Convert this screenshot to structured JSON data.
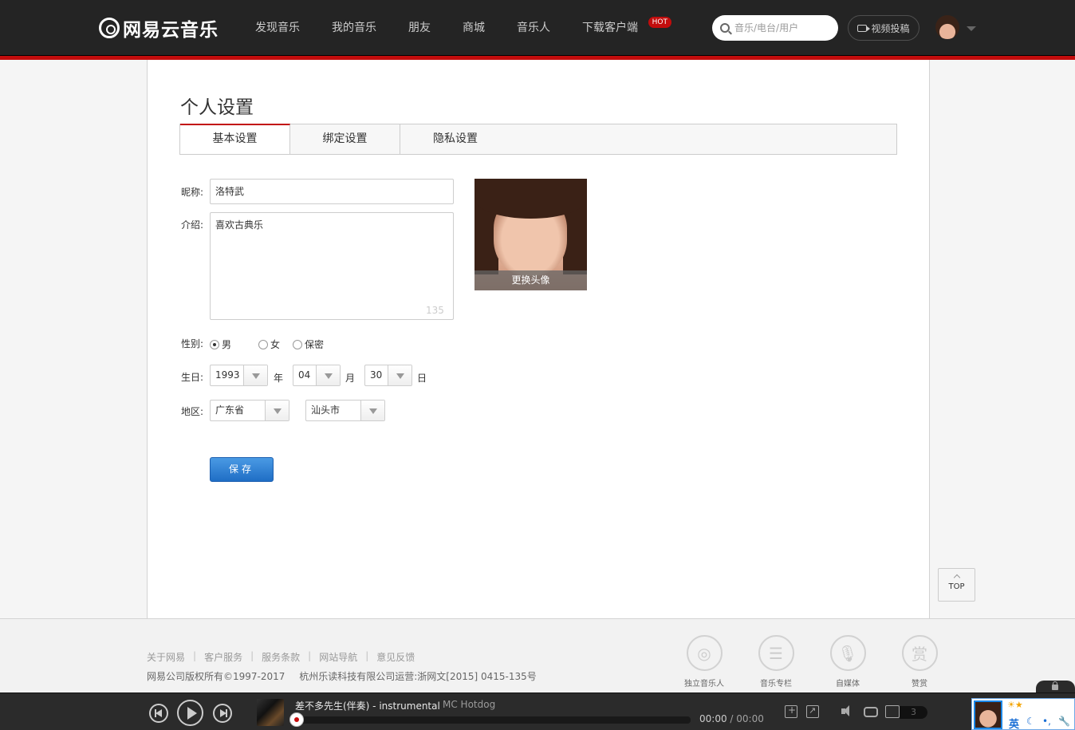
{
  "nav": {
    "logo_text": "网易云音乐",
    "items": [
      "发现音乐",
      "我的音乐",
      "朋友",
      "商城",
      "音乐人",
      "下载客户端"
    ],
    "hot_badge": "HOT",
    "search_placeholder": "音乐/电台/用户",
    "upload_label": "视频投稿"
  },
  "page": {
    "title": "个人设置",
    "tabs": [
      "基本设置",
      "绑定设置",
      "隐私设置"
    ],
    "active_tab": "基本设置"
  },
  "form": {
    "nickname_label": "昵称:",
    "nickname_value": "洛特武",
    "intro_label": "介绍:",
    "intro_value": "喜欢古典乐",
    "intro_remaining": "135",
    "avatar_change_label": "更换头像",
    "gender_label": "性别:",
    "gender_options": [
      "男",
      "女",
      "保密"
    ],
    "gender_selected": "男",
    "birthday_label": "生日:",
    "birth_year": "1993",
    "birth_month": "04",
    "birth_day": "30",
    "year_unit": "年",
    "month_unit": "月",
    "day_unit": "日",
    "region_label": "地区:",
    "province": "广东省",
    "city": "汕头市",
    "save_label": "保存"
  },
  "top_button": "TOP",
  "footer": {
    "links": [
      "关于网易",
      "客户服务",
      "服务条款",
      "网站导航",
      "意见反馈"
    ],
    "separator": "|",
    "copyright": "网易公司版权所有©1997-2017",
    "operator": "杭州乐读科技有限公司运营:浙网文[2015] 0415-135号",
    "icons": [
      {
        "label": "独立音乐人",
        "icon": "independent-musician-icon"
      },
      {
        "label": "音乐专栏",
        "icon": "music-column-icon"
      },
      {
        "label": "自媒体",
        "icon": "microphone-icon"
      },
      {
        "label": "赞赏",
        "icon": "reward-icon",
        "glyph": "赏"
      }
    ]
  },
  "player": {
    "song_title": "差不多先生(伴奏) - instrumental",
    "artist": "MC Hotdog",
    "current_time": "00:00",
    "separator": " / ",
    "total_time": "00:00",
    "playlist_count": "3",
    "progress": 0
  },
  "ime": {
    "lang": "英"
  },
  "colors": {
    "brand_red": "#c20c0c",
    "nav_bg": "#242424",
    "save_blue": "#1f6ec5"
  }
}
